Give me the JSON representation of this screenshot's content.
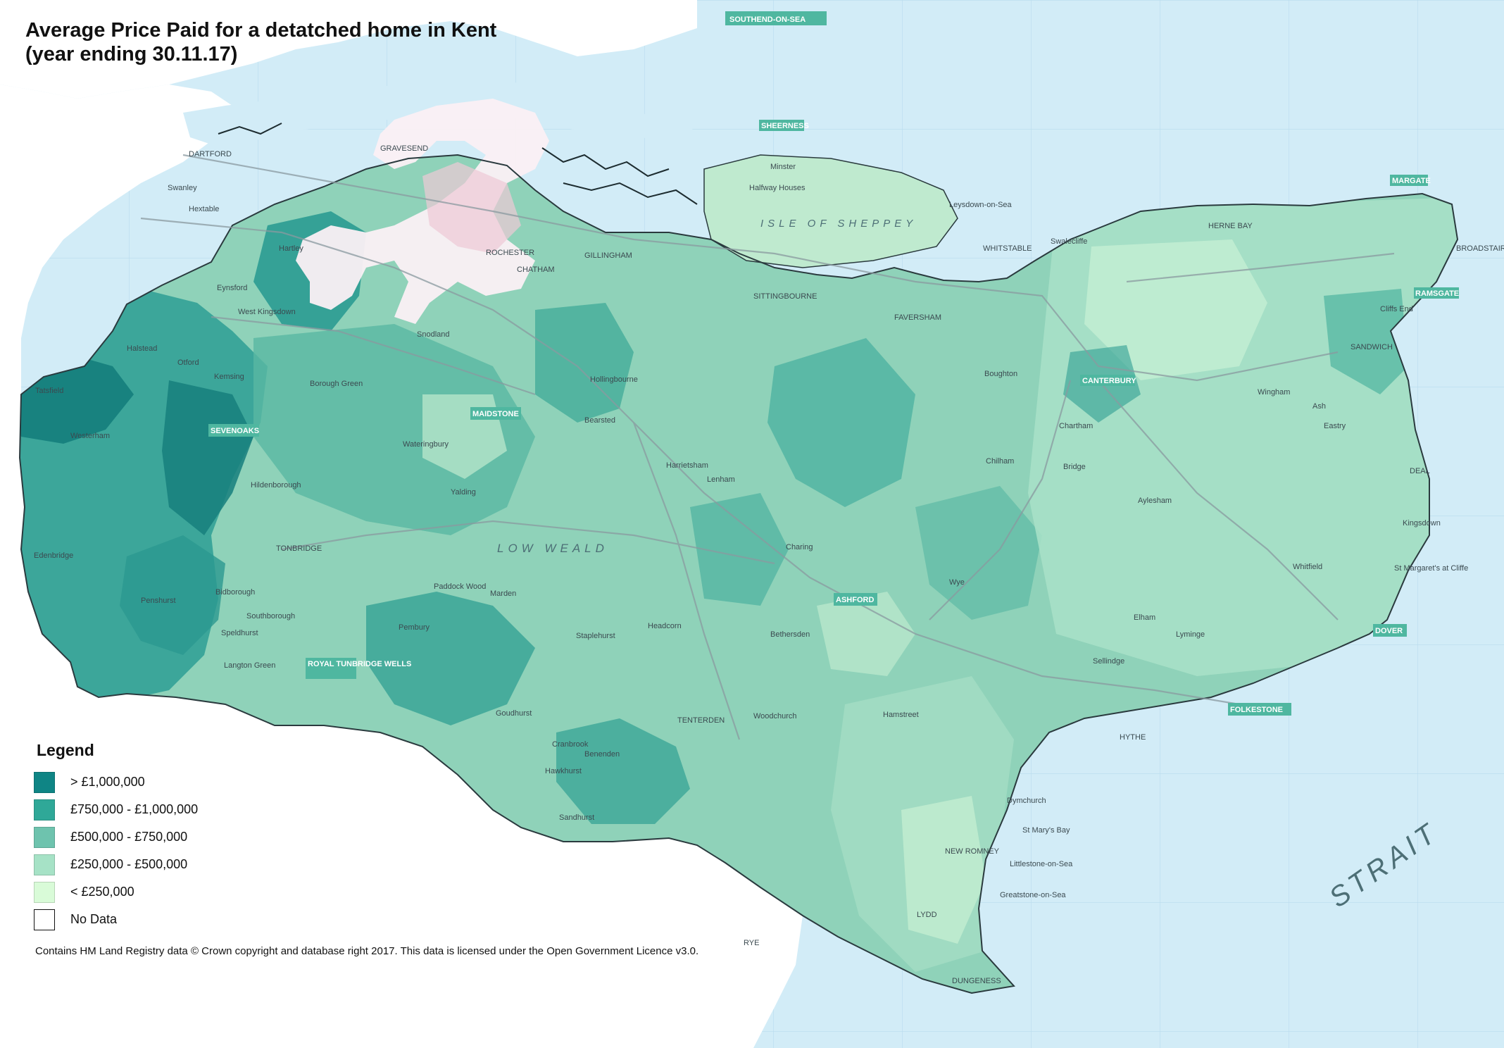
{
  "title": {
    "line1": "Average Price Paid for a detatched home in Kent",
    "line2": "(year ending 30.11.17)"
  },
  "legend": {
    "heading": "Legend",
    "items": [
      {
        "label": "> £1,000,000",
        "color": "#0f8585"
      },
      {
        "label": "£750,000 - £1,000,000",
        "color": "#2fa898"
      },
      {
        "label": "£500,000 - £750,000",
        "color": "#6ec3ae"
      },
      {
        "label": "£250,000 - £500,000",
        "color": "#a6e2c6"
      },
      {
        "label": "< £250,000",
        "color": "#d9fbd8"
      },
      {
        "label": "No Data",
        "color": "#ffffff"
      }
    ]
  },
  "credit": "Contains HM Land Registry data © Crown copyright and database right 2017. This data is licensed under the Open Government Licence v3.0.",
  "colors": {
    "sea": "#d2ecf7",
    "land_outside": "#ffffff",
    "road": "#9aa8ad",
    "kent_outline": "#2a3a3e"
  },
  "town_labels": [
    "SOUTHEND-ON-SEA",
    "SHEERNESS",
    "MARGATE",
    "RAMSGATE",
    "SEVENOAKS",
    "MAIDSTONE",
    "CANTERBURY",
    "ASHFORD",
    "DOVER",
    "FOLKESTONE",
    "ROYAL TUNBRIDGE WELLS"
  ],
  "places": [
    "DARTFORD",
    "GRAVESEND",
    "Swanley",
    "Hextable",
    "Hartley",
    "Eynsford",
    "West Kingsdown",
    "Halstead",
    "Otford",
    "Kemsing",
    "Tatsfield",
    "Westerham",
    "Edenbridge",
    "Hildenborough",
    "TONBRIDGE",
    "Southborough",
    "Penshurst",
    "Bidborough",
    "Speldhurst",
    "Langton Green",
    "Paddock Wood",
    "Pembury",
    "Snodland",
    "ROCHESTER",
    "CHATHAM",
    "GILLINGHAM",
    "SITTINGBOURNE",
    "FAVERSHAM",
    "WHITSTABLE",
    "HERNE BAY",
    "Swalecliffe",
    "Leysdown-on-Sea",
    "Minster",
    "Halfway Houses",
    "BROADSTAIRS",
    "Cliffs End",
    "SANDWICH",
    "DEAL",
    "Kingsdown",
    "St Margaret's at Cliffe",
    "Whitfield",
    "HYTHE",
    "Dymchurch",
    "St Mary's Bay",
    "NEW ROMNEY",
    "Littlestone-on-Sea",
    "Greatstone-on-Sea",
    "LYDD",
    "DUNGENESS",
    "RYE",
    "TENTERDEN",
    "Cranbrook",
    "Goudhurst",
    "Staplehurst",
    "Headcorn",
    "Hawkhurst",
    "Sandhurst",
    "Benenden",
    "Marden",
    "Charing",
    "Wye",
    "Chilham",
    "Bridge",
    "Aylesham",
    "Elham",
    "Lyminge",
    "Sellindge",
    "Hamstreet",
    "Woodchurch",
    "Bethersden",
    "Lenham",
    "Harrietsham",
    "Hollingbourne",
    "Bearsted",
    "Wateringbury",
    "Yalding",
    "Borough Green",
    "Chartham",
    "Boughton",
    "Ash",
    "Eastry",
    "Wingham"
  ],
  "regions": [
    {
      "text": "ISLE OF SHEPPEY"
    },
    {
      "text": "LOW WEALD"
    },
    {
      "text": "STRAIT"
    }
  ]
}
